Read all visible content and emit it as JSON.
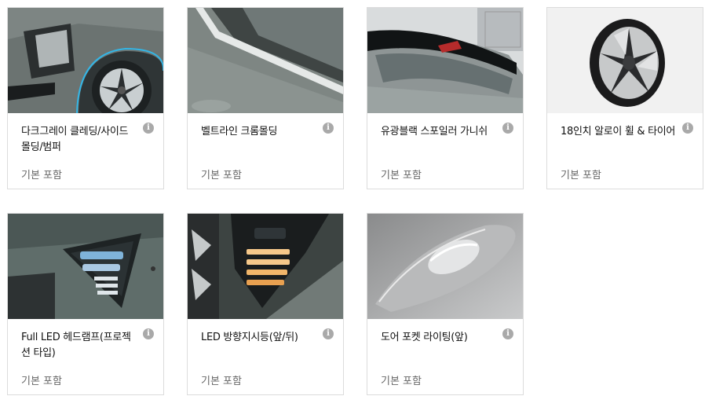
{
  "options": [
    {
      "title": "다크그레이 클레딩/사이드 몰딩/범퍼",
      "price": "기본 포함",
      "info_icon": "i"
    },
    {
      "title": "벨트라인 크롬몰딩",
      "price": "기본 포함",
      "info_icon": "i"
    },
    {
      "title": "유광블랙 스포일러 가니쉬",
      "price": "기본 포함",
      "info_icon": "i"
    },
    {
      "title": "18인치 알로이 휠 & 타이어",
      "price": "기본 포함",
      "info_icon": "i"
    },
    {
      "title": "Full LED 헤드램프(프로젝션 타입)",
      "price": "기본 포함",
      "info_icon": "i"
    },
    {
      "title": "LED 방향지시등(앞/뒤)",
      "price": "기본 포함",
      "info_icon": "i"
    },
    {
      "title": "도어 포켓 라이팅(앞)",
      "price": "기본 포함",
      "info_icon": "i"
    }
  ]
}
